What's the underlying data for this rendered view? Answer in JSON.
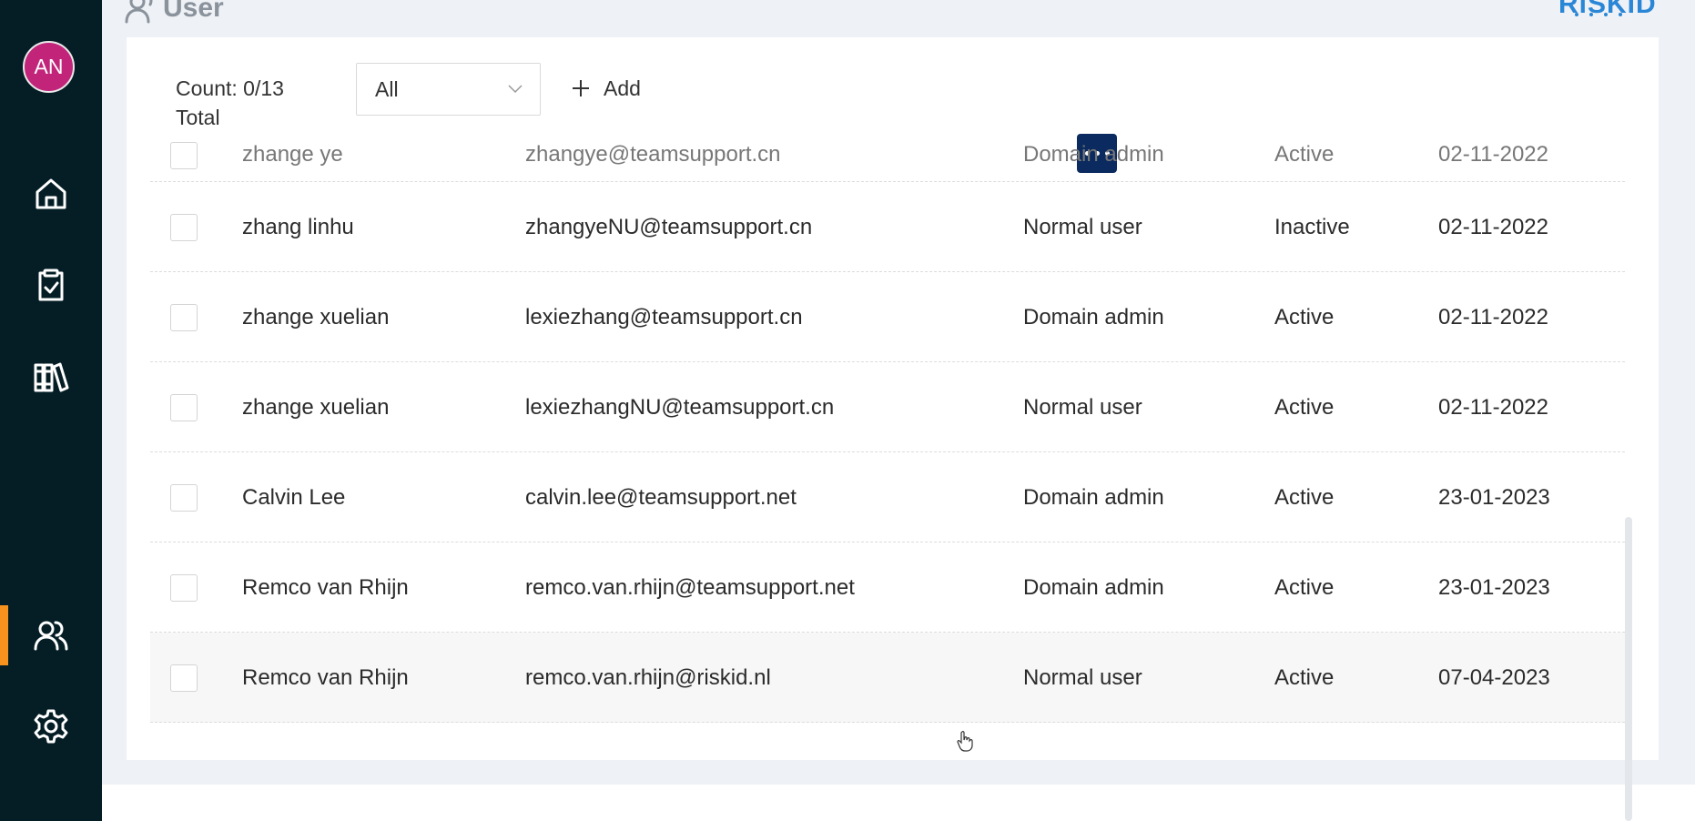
{
  "sidebar": {
    "avatar_initials": "AN",
    "items": [
      {
        "name": "home",
        "icon": "home-icon"
      },
      {
        "name": "tasks",
        "icon": "clipboard-check-icon"
      },
      {
        "name": "library",
        "icon": "library-icon"
      },
      {
        "name": "users",
        "icon": "users-icon",
        "active": true
      },
      {
        "name": "settings",
        "icon": "gear-icon"
      }
    ],
    "accent_color": "#f7921e",
    "background": "#051e26"
  },
  "header": {
    "title": "User",
    "logo_text": "RiSKID"
  },
  "toolbar": {
    "count_label": "Count: 0/13",
    "total_label": "Total",
    "filter_value": "All",
    "add_label": "Add"
  },
  "table": {
    "partial_row": {
      "name": "zhange ye",
      "email": "zhangye@teamsupport.cn",
      "role": "Domain admin",
      "status": "Active",
      "date": "02-11-2022"
    },
    "rows": [
      {
        "name": "zhang linhu",
        "email": "zhangyeNU@teamsupport.cn",
        "role": "Normal user",
        "status": "Inactive",
        "date": "02-11-2022"
      },
      {
        "name": "zhange xuelian",
        "email": "lexiezhang@teamsupport.cn",
        "role": "Domain admin",
        "status": "Active",
        "date": "02-11-2022"
      },
      {
        "name": "zhange xuelian",
        "email": "lexiezhangNU@teamsupport.cn",
        "role": "Normal user",
        "status": "Active",
        "date": "02-11-2022"
      },
      {
        "name": "Calvin Lee",
        "email": "calvin.lee@teamsupport.net",
        "role": "Domain admin",
        "status": "Active",
        "date": "23-01-2023"
      },
      {
        "name": "Remco van Rhijn",
        "email": "remco.van.rhijn@teamsupport.net",
        "role": "Domain admin",
        "status": "Active",
        "date": "23-01-2023"
      },
      {
        "name": "Remco van Rhijn",
        "email": "remco.van.rhijn@riskid.nl",
        "role": "Normal user",
        "status": "Active",
        "date": "07-04-2023"
      }
    ]
  }
}
